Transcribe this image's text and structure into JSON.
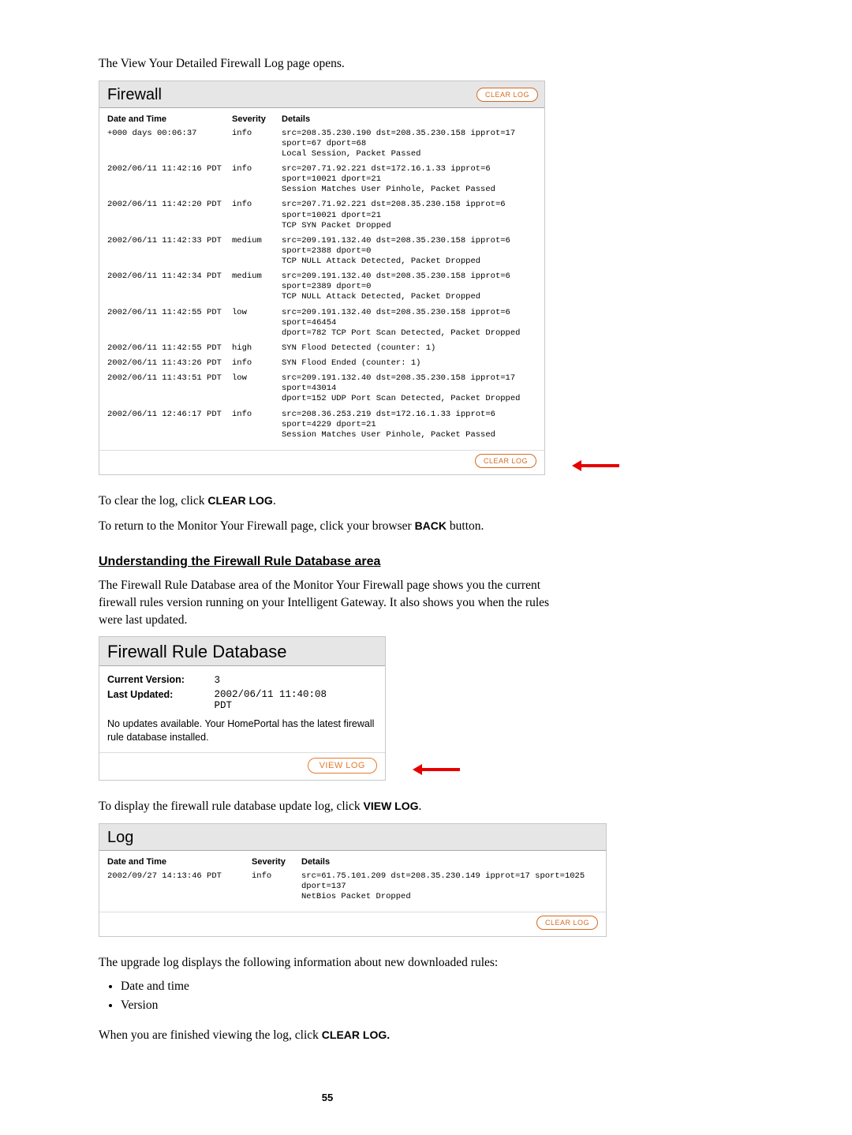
{
  "intro_line": "The View Your Detailed Firewall Log page opens.",
  "firewall_panel": {
    "title": "Firewall",
    "clear_label": "CLEAR LOG",
    "headers": {
      "dt": "Date and Time",
      "sev": "Severity",
      "det": "Details"
    },
    "rows": [
      {
        "dt": "+000 days 00:06:37",
        "sev": "info",
        "det": "src=208.35.230.190 dst=208.35.230.158 ipprot=17 sport=67 dport=68\nLocal Session, Packet Passed"
      },
      {
        "dt": "2002/06/11 11:42:16 PDT",
        "sev": "info",
        "det": "src=207.71.92.221 dst=172.16.1.33 ipprot=6 sport=10021 dport=21\nSession Matches User Pinhole, Packet Passed"
      },
      {
        "dt": "2002/06/11 11:42:20 PDT",
        "sev": "info",
        "det": "src=207.71.92.221 dst=208.35.230.158 ipprot=6 sport=10021 dport=21\nTCP SYN Packet Dropped"
      },
      {
        "dt": "2002/06/11 11:42:33 PDT",
        "sev": "medium",
        "det": "src=209.191.132.40 dst=208.35.230.158 ipprot=6 sport=2388 dport=0\nTCP NULL Attack Detected, Packet Dropped"
      },
      {
        "dt": "2002/06/11 11:42:34 PDT",
        "sev": "medium",
        "det": "src=209.191.132.40 dst=208.35.230.158 ipprot=6 sport=2389 dport=0\nTCP NULL Attack Detected, Packet Dropped"
      },
      {
        "dt": "2002/06/11 11:42:55 PDT",
        "sev": "low",
        "det": "src=209.191.132.40 dst=208.35.230.158 ipprot=6 sport=46454\ndport=782 TCP Port Scan Detected, Packet Dropped"
      },
      {
        "dt": "2002/06/11 11:42:55 PDT",
        "sev": "high",
        "det": "SYN Flood Detected (counter: 1)"
      },
      {
        "dt": "2002/06/11 11:43:26 PDT",
        "sev": "info",
        "det": "SYN Flood Ended (counter: 1)"
      },
      {
        "dt": "2002/06/11 11:43:51 PDT",
        "sev": "low",
        "det": "src=209.191.132.40 dst=208.35.230.158 ipprot=17 sport=43014\ndport=152 UDP Port Scan Detected, Packet Dropped"
      },
      {
        "dt": "2002/06/11 12:46:17 PDT",
        "sev": "info",
        "det": "src=208.36.253.219 dst=172.16.1.33 ipprot=6 sport=4229 dport=21\nSession Matches User Pinhole, Packet Passed"
      }
    ]
  },
  "clear_instr_pre": "To clear the log, click ",
  "clear_instr_bold": "CLEAR LOG",
  "clear_instr_post": ".",
  "back_instr_pre": "To return to the Monitor Your Firewall page, click your browser ",
  "back_instr_bold": "BACK",
  "back_instr_post": " button.",
  "heading_frd": "Understanding the Firewall Rule Database area",
  "frd_desc": "The Firewall Rule Database area of the Monitor Your Firewall page shows you the current firewall rules version running on your Intelligent Gateway. It also shows you when the rules were last updated.",
  "frd_panel": {
    "title": "Firewall Rule Database",
    "current_label": "Current Version:",
    "current_value": "3",
    "updated_label": "Last Updated:",
    "updated_value": "2002/06/11 11:40:08\nPDT",
    "no_updates": "No updates available. Your HomePortal has the latest firewall rule database installed.",
    "view_label": "VIEW LOG"
  },
  "viewlog_instr_pre": "To display the firewall rule database update log, click ",
  "viewlog_instr_bold": "VIEW LOG",
  "viewlog_instr_post": ".",
  "log_panel": {
    "title": "Log",
    "clear_label": "CLEAR LOG",
    "headers": {
      "dt": "Date and Time",
      "sev": "Severity",
      "det": "Details"
    },
    "rows": [
      {
        "dt": "2002/09/27 14:13:46 PDT",
        "sev": "info",
        "det": "src=61.75.101.209 dst=208.35.230.149 ipprot=17 sport=1025 dport=137\nNetBios Packet Dropped"
      }
    ]
  },
  "upgrade_desc": "The upgrade log displays the following information about new downloaded rules:",
  "bullets": {
    "b1": "Date and time",
    "b2": "Version"
  },
  "finish_pre": "When you are finished viewing the log, click ",
  "finish_bold": "CLEAR LOG.",
  "page_num": "55"
}
